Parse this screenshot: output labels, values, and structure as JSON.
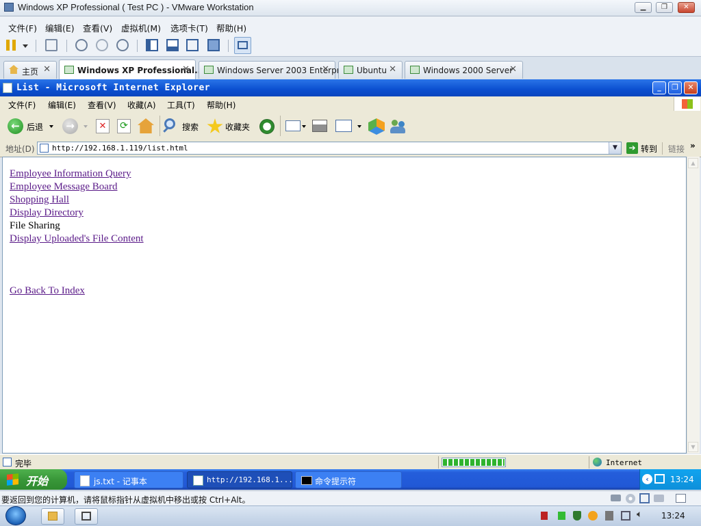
{
  "vmware": {
    "title": "Windows XP Professional ( Test PC ) - VMware Workstation",
    "menu": [
      "文件(F)",
      "编辑(E)",
      "查看(V)",
      "虚拟机(M)",
      "选项卡(T)",
      "帮助(H)"
    ],
    "tabs": [
      {
        "label": "主页",
        "close": "✕"
      },
      {
        "label": "Windows XP Professional...",
        "close": "✕"
      },
      {
        "label": "Windows Server 2003 Enterpr...",
        "close": "✕"
      },
      {
        "label": "Ubuntu",
        "close": "✕"
      },
      {
        "label": "Windows 2000 Server",
        "close": "✕"
      }
    ],
    "hint": "要返回到您的计算机，请将鼠标指针从虚拟机中移出或按 Ctrl+Alt。"
  },
  "ie": {
    "title": "List - Microsoft Internet Explorer",
    "menu": [
      "文件(F)",
      "编辑(E)",
      "查看(V)",
      "收藏(A)",
      "工具(T)",
      "帮助(H)"
    ],
    "toolbar": {
      "back": "后退",
      "search": "搜索",
      "favorites": "收藏夹"
    },
    "address_label": "地址(D)",
    "url": "http://192.168.1.119/list.html",
    "go": "转到",
    "links_label": "链接",
    "status_text": "完毕",
    "zone": "Internet",
    "progress": 1.0
  },
  "page": {
    "links": [
      "Employee Information Query",
      "Employee Message Board",
      "Shopping Hall",
      "Display Directory",
      "File Sharing",
      "Display Uploaded's File Content"
    ],
    "back_link": "Go Back To Index"
  },
  "xp_taskbar": {
    "start": "开始",
    "items": [
      "js.txt - 记事本",
      "http://192.168.1...",
      "命令提示符"
    ],
    "clock": "13:24"
  },
  "win7_taskbar": {
    "clock": "13:24"
  },
  "colors": {
    "xp_blue": "#245edb",
    "link_visited": "#5a1a88"
  }
}
